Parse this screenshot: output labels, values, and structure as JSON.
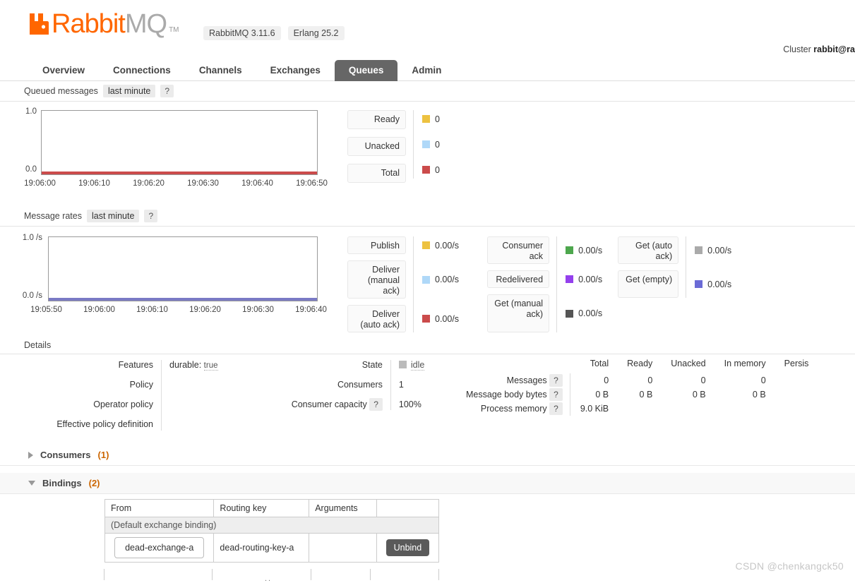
{
  "header": {
    "logo_rabbit": "Rabbit",
    "logo_mq": "MQ",
    "logo_tm": "TM",
    "version_rabbitmq": "RabbitMQ 3.11.6",
    "version_erlang": "Erlang 25.2",
    "cluster_prefix": "Cluster ",
    "cluster_name": "rabbit@ra"
  },
  "nav": {
    "items": [
      {
        "label": "Overview",
        "active": false
      },
      {
        "label": "Connections",
        "active": false
      },
      {
        "label": "Channels",
        "active": false
      },
      {
        "label": "Exchanges",
        "active": false
      },
      {
        "label": "Queues",
        "active": true
      },
      {
        "label": "Admin",
        "active": false
      }
    ]
  },
  "queued_messages": {
    "title": "Queued messages",
    "period": "last minute",
    "help": "?",
    "legend": [
      {
        "label": "Ready",
        "value": "0",
        "color": "#EDC240"
      },
      {
        "label": "Unacked",
        "value": "0",
        "color": "#AFD8F8"
      },
      {
        "label": "Total",
        "value": "0",
        "color": "#CB4B4B"
      }
    ]
  },
  "message_rates": {
    "title": "Message rates",
    "period": "last minute",
    "help": "?",
    "col1": [
      {
        "label": "Publish",
        "value": "0.00/s",
        "color": "#EDC240"
      },
      {
        "label": "Deliver (manual ack)",
        "value": "0.00/s",
        "color": "#AFD8F8"
      },
      {
        "label": "Deliver (auto ack)",
        "value": "0.00/s",
        "color": "#CB4B4B"
      }
    ],
    "col2": [
      {
        "label": "Consumer ack",
        "value": "0.00/s",
        "color": "#4DA74D"
      },
      {
        "label": "Redelivered",
        "value": "0.00/s",
        "color": "#9440ED"
      },
      {
        "label": "Get (manual ack)",
        "value": "0.00/s",
        "color": "#555555"
      }
    ],
    "col3": [
      {
        "label": "Get (auto ack)",
        "value": "0.00/s",
        "color": "#AAAAAA"
      },
      {
        "label": "Get (empty)",
        "value": "0.00/s",
        "color": "#6B6BD6"
      }
    ]
  },
  "chart_data": [
    {
      "type": "line",
      "title": "Queued messages",
      "subtitle": "last minute",
      "xlabel": "",
      "ylabel": "",
      "ylim": [
        0.0,
        1.0
      ],
      "ytick_labels": [
        "1.0",
        "0.0"
      ],
      "xtick_labels": [
        "19:06:00",
        "19:06:10",
        "19:06:20",
        "19:06:30",
        "19:06:40",
        "19:06:50"
      ],
      "grid": false,
      "legend_position": "right",
      "series": [
        {
          "name": "Ready",
          "color": "#EDC240",
          "values": [
            0,
            0,
            0,
            0,
            0,
            0
          ]
        },
        {
          "name": "Unacked",
          "color": "#AFD8F8",
          "values": [
            0,
            0,
            0,
            0,
            0,
            0
          ]
        },
        {
          "name": "Total",
          "color": "#CB4B4B",
          "values": [
            0,
            0,
            0,
            0,
            0,
            0
          ]
        }
      ]
    },
    {
      "type": "line",
      "title": "Message rates",
      "subtitle": "last minute",
      "xlabel": "",
      "ylabel": "",
      "ylim": [
        0.0,
        1.0
      ],
      "ytick_labels": [
        "1.0 /s",
        "0.0 /s"
      ],
      "xtick_labels": [
        "19:05:50",
        "19:06:00",
        "19:06:10",
        "19:06:20",
        "19:06:30",
        "19:06:40"
      ],
      "grid": false,
      "legend_position": "right",
      "series": [
        {
          "name": "Publish",
          "color": "#EDC240",
          "values": [
            0,
            0,
            0,
            0,
            0,
            0
          ]
        },
        {
          "name": "Deliver (manual ack)",
          "color": "#AFD8F8",
          "values": [
            0,
            0,
            0,
            0,
            0,
            0
          ]
        },
        {
          "name": "Deliver (auto ack)",
          "color": "#CB4B4B",
          "values": [
            0,
            0,
            0,
            0,
            0,
            0
          ]
        },
        {
          "name": "Consumer ack",
          "color": "#4DA74D",
          "values": [
            0,
            0,
            0,
            0,
            0,
            0
          ]
        },
        {
          "name": "Redelivered",
          "color": "#9440ED",
          "values": [
            0,
            0,
            0,
            0,
            0,
            0
          ]
        },
        {
          "name": "Get (manual ack)",
          "color": "#555555",
          "values": [
            0,
            0,
            0,
            0,
            0,
            0
          ]
        },
        {
          "name": "Get (auto ack)",
          "color": "#AAAAAA",
          "values": [
            0,
            0,
            0,
            0,
            0,
            0
          ]
        },
        {
          "name": "Get (empty)",
          "color": "#6B6BD6",
          "values": [
            0,
            0,
            0,
            0,
            0,
            0
          ]
        }
      ]
    }
  ],
  "details": {
    "title": "Details",
    "left_labels": [
      "Features",
      "Policy",
      "Operator policy",
      "Effective policy definition"
    ],
    "features_key": "durable:",
    "features_value": "true",
    "mid_labels": [
      "State",
      "Consumers",
      "Consumer capacity"
    ],
    "consumer_capacity_help": "?",
    "state_value": "idle",
    "consumers_value": "1",
    "consumer_capacity_value": "100%",
    "stats_columns": [
      "Total",
      "Ready",
      "Unacked",
      "In memory",
      "Persis"
    ],
    "stats_rows": [
      {
        "label": "Messages",
        "help": "?",
        "values": [
          "0",
          "0",
          "0",
          "0",
          ""
        ]
      },
      {
        "label": "Message body bytes",
        "help": "?",
        "values": [
          "0 B",
          "0 B",
          "0 B",
          "0 B",
          ""
        ]
      },
      {
        "label": "Process memory",
        "help": "?",
        "values": [
          "9.0 KiB",
          "",
          "",
          "",
          ""
        ]
      }
    ]
  },
  "consumers_section": {
    "label": "Consumers",
    "count": "(1)",
    "expanded": false
  },
  "bindings_section": {
    "label": "Bindings",
    "count": "(2)",
    "expanded": true,
    "columns": [
      "From",
      "Routing key",
      "Arguments",
      ""
    ],
    "default_binding_note": "(Default exchange binding)",
    "rows": [
      {
        "from": "dead-exchange-a",
        "routing_key": "dead-routing-key-a",
        "arguments": "",
        "action": "Unbind"
      }
    ]
  },
  "watermark": "CSDN @chenkangck50"
}
